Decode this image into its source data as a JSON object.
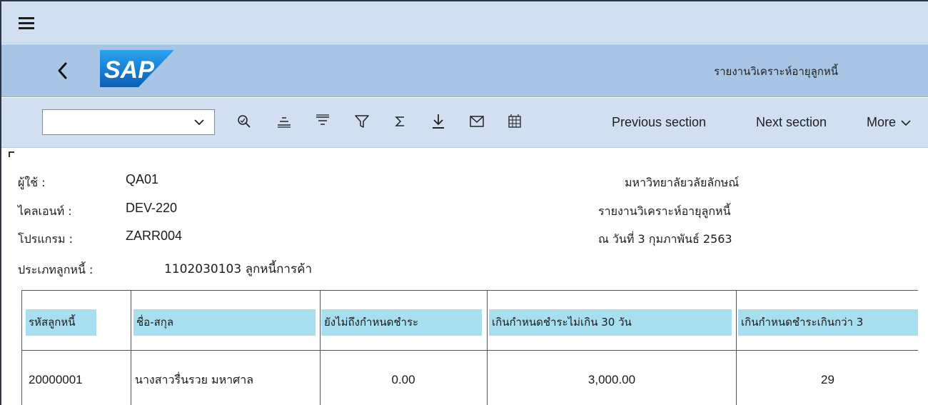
{
  "menu": {
    "hamburger_icon": "hamburger-menu-icon"
  },
  "titlebar": {
    "logo_text": "SAP",
    "title": "รายงานวิเคราะห์อายุลูกหนี้",
    "brand_color": "#1470c8"
  },
  "toolbar": {
    "combo_value": "",
    "icons": [
      "find-icon",
      "sort-ascending-icon",
      "sort-descending-icon",
      "filter-icon",
      "sum-icon",
      "download-icon",
      "mail-icon",
      "spreadsheet-icon"
    ],
    "previous_section": "Previous section",
    "next_section": "Next section",
    "more": "More"
  },
  "report": {
    "user_label": "ผู้ใช้  :",
    "user_value": "QA01",
    "client_label": "ไคลเอนท์ :",
    "client_value": "DEV-220",
    "program_label": "โปรแกรม  :",
    "program_value": "ZARR004",
    "debtor_type_label": "ประเภทลูกหนี้ :",
    "debtor_type_value": "1102030103  ลูกหนี้การค้า",
    "org_name": "มหาวิทยาลัยวลัยลักษณ์",
    "report_title": "รายงานวิเคราะห์อายุลูกหนี้",
    "as_of_date": "ณ วันที่ 3 กุมภาพันธ์ 2563"
  },
  "table": {
    "headers": [
      "รหัสลูกหนี้",
      "ชื่อ-สกุล",
      "ยังไม่ถึงกำหนดชำระ",
      "เกินกำหนดชำระไม่เกิน 30 วัน",
      "เกินกำหนดชำระเกินกว่า 3"
    ],
    "rows": [
      [
        "20000001",
        "นางสาวรื่นรวย มหาศาล",
        "0.00",
        "3,000.00",
        "29"
      ]
    ],
    "header_color": "#a8dff0"
  }
}
